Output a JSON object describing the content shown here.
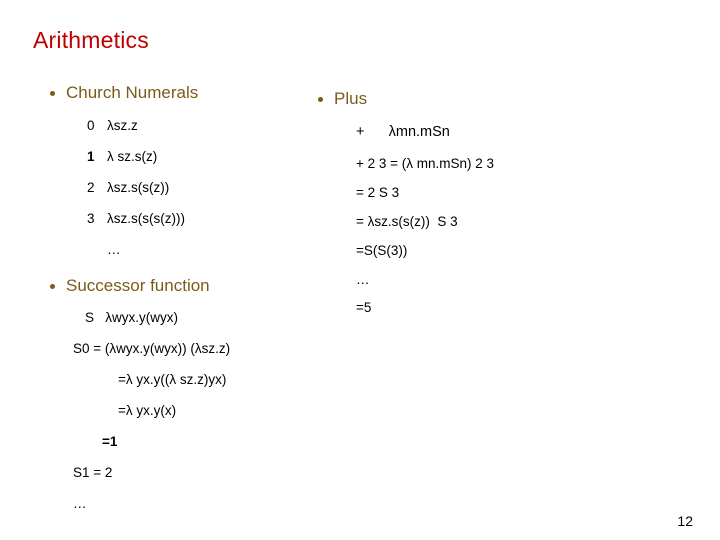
{
  "slide": {
    "title": "Arithmetics",
    "page_number": "12",
    "title_color": "#C00000",
    "heading_color": "#7A5C18",
    "body_color": "#000000",
    "background_color": "#FFFFFF"
  },
  "left_column": {
    "section_church": {
      "heading": "Church Numerals",
      "rows": [
        {
          "index": "0",
          "expr": "λsz.z"
        },
        {
          "index": "1",
          "expr": "λ sz.s(z)"
        },
        {
          "index": "2",
          "expr": "λsz.s(s(z))"
        },
        {
          "index": "3",
          "expr": "λsz.s(s(s(z)))"
        },
        {
          "index": "",
          "expr": "…"
        }
      ]
    },
    "section_successor": {
      "heading": "Successor function",
      "lines": [
        "S   λwyx.y(wyx)",
        "S0 = (λwyx.y(wyx)) (λsz.z)",
        "=λ yx.y((λ sz.z)yx)",
        "=λ yx.y(x)",
        "=1",
        "S1 = 2",
        "…"
      ]
    }
  },
  "right_column": {
    "section_plus": {
      "heading": "Plus",
      "lines": [
        "+      λmn.mSn",
        "+ 2 3 = (λ mn.mSn) 2 3",
        "= 2 S 3",
        "= λsz.s(s(z))  S 3",
        "=S(S(3))",
        "…",
        "=5"
      ]
    }
  }
}
